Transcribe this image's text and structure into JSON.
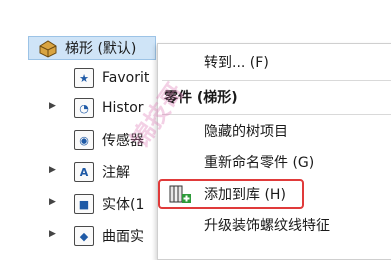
{
  "tree": {
    "root_label": "梯形 (默认)",
    "items": [
      {
        "label": "Favorit",
        "icon": "star-folder-icon",
        "expandable": false
      },
      {
        "label": "Histor",
        "icon": "history-folder-icon",
        "expandable": true
      },
      {
        "label": "传感器",
        "icon": "sensor-folder-icon",
        "expandable": false
      },
      {
        "label": "注解",
        "icon": "annotation-folder-icon",
        "expandable": true
      },
      {
        "label": "实体(1",
        "icon": "solid-bodies-folder-icon",
        "expandable": true
      },
      {
        "label": "曲面实",
        "icon": "surface-bodies-folder-icon",
        "expandable": true
      }
    ]
  },
  "context_menu": {
    "goto": "转到... (F)",
    "header": "零件 (梯形)",
    "hide_tree_items": "隐藏的树项目",
    "rename_part": "重新命名零件 (G)",
    "add_to_library": "添加到库 (H)",
    "upgrade_cosmetic_thread": "升级装饰螺纹线特征"
  },
  "watermark_text": "锦技哥",
  "colors": {
    "selection_bg": "#cfe4f7",
    "highlight_border": "#e03a3a"
  }
}
